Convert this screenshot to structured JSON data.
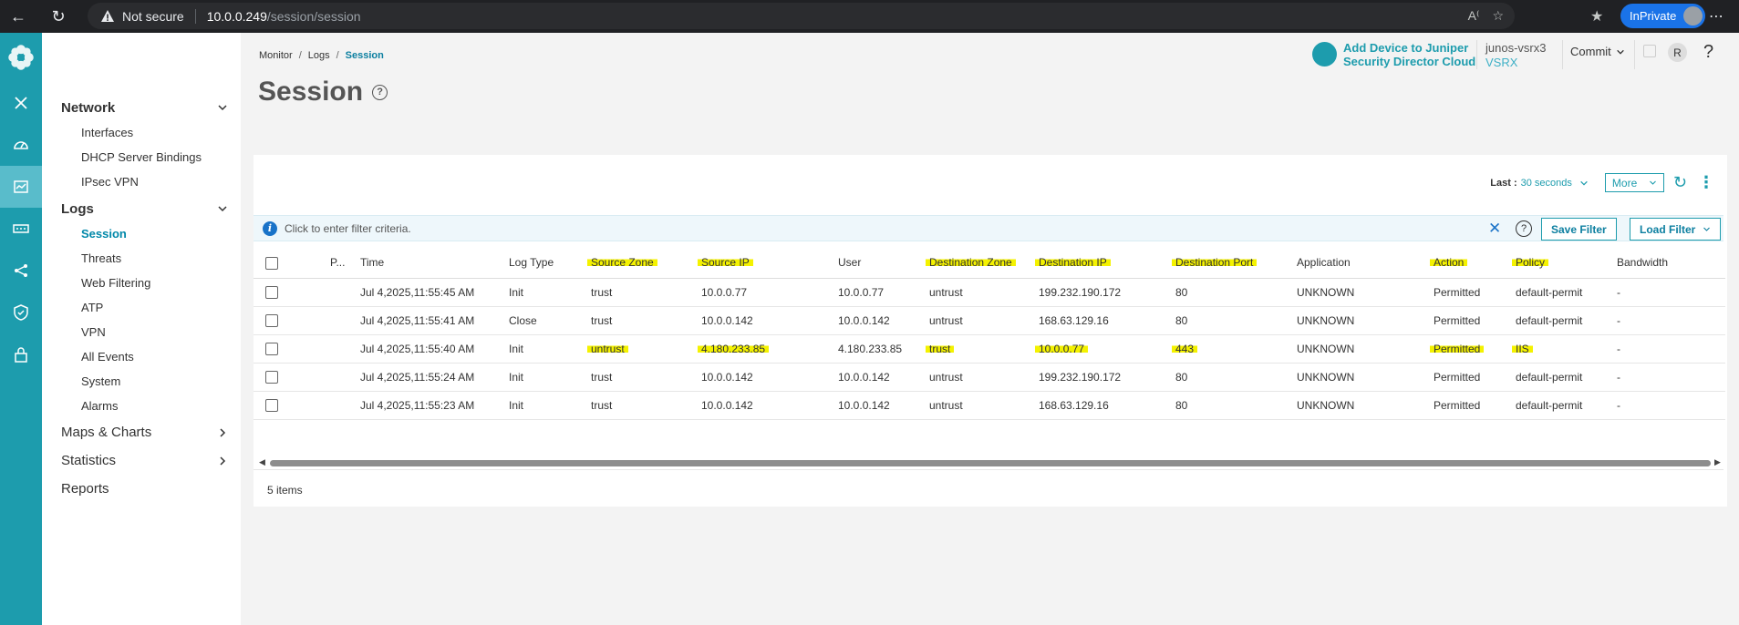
{
  "browser": {
    "not_secure": "Not secure",
    "host": "10.0.0.249",
    "path": "/session/session",
    "inprivate": "InPrivate"
  },
  "nav": {
    "network": "Network",
    "network_items": [
      "Interfaces",
      "DHCP Server Bindings",
      "IPsec VPN"
    ],
    "logs": "Logs",
    "logs_items": [
      "Session",
      "Threats",
      "Web Filtering",
      "ATP",
      "VPN",
      "All Events",
      "System",
      "Alarms"
    ],
    "maps_charts": "Maps & Charts",
    "statistics": "Statistics",
    "reports": "Reports"
  },
  "header": {
    "breadcrumb": [
      "Monitor",
      "Logs",
      "Session"
    ],
    "title": "Session",
    "add_device_line1": "Add Device to Juniper",
    "add_device_line2": "Security Director Cloud",
    "device_name": "junos-vsrx3",
    "device_model": "VSRX",
    "commit": "Commit",
    "user_initial": "R",
    "help": "?"
  },
  "toolbar": {
    "last_label": "Last :",
    "last_value": "30 seconds",
    "more": "More"
  },
  "filter": {
    "placeholder": "Click to enter filter criteria.",
    "save": "Save Filter",
    "load": "Load Filter"
  },
  "table": {
    "columns": [
      "P...",
      "Time",
      "Log Type",
      "Source Zone",
      "Source IP",
      "User",
      "Destination Zone",
      "Destination IP",
      "Destination Port",
      "Application",
      "Action",
      "Policy",
      "Bandwidth"
    ],
    "rows": [
      [
        "",
        "Jul 4,2025,11:55:45 AM",
        "Init",
        "trust",
        "10.0.0.77",
        "10.0.0.77",
        "untrust",
        "199.232.190.172",
        "80",
        "UNKNOWN",
        "Permitted",
        "default-permit",
        "-"
      ],
      [
        "",
        "Jul 4,2025,11:55:41 AM",
        "Close",
        "trust",
        "10.0.0.142",
        "10.0.0.142",
        "untrust",
        "168.63.129.16",
        "80",
        "UNKNOWN",
        "Permitted",
        "default-permit",
        "-"
      ],
      [
        "",
        "Jul 4,2025,11:55:40 AM",
        "Init",
        "untrust",
        "4.180.233.85",
        "4.180.233.85",
        "trust",
        "10.0.0.77",
        "443",
        "UNKNOWN",
        "Permitted",
        "IIS",
        "-"
      ],
      [
        "",
        "Jul 4,2025,11:55:24 AM",
        "Init",
        "trust",
        "10.0.0.142",
        "10.0.0.142",
        "untrust",
        "199.232.190.172",
        "80",
        "UNKNOWN",
        "Permitted",
        "default-permit",
        "-"
      ],
      [
        "",
        "Jul 4,2025,11:55:23 AM",
        "Init",
        "trust",
        "10.0.0.142",
        "10.0.0.142",
        "untrust",
        "168.63.129.16",
        "80",
        "UNKNOWN",
        "Permitted",
        "default-permit",
        "-"
      ]
    ],
    "item_count": "5 items"
  },
  "colors": {
    "rail": "#1d9cad",
    "accent": "#0c7fa0",
    "highlight": "#f4f200"
  }
}
